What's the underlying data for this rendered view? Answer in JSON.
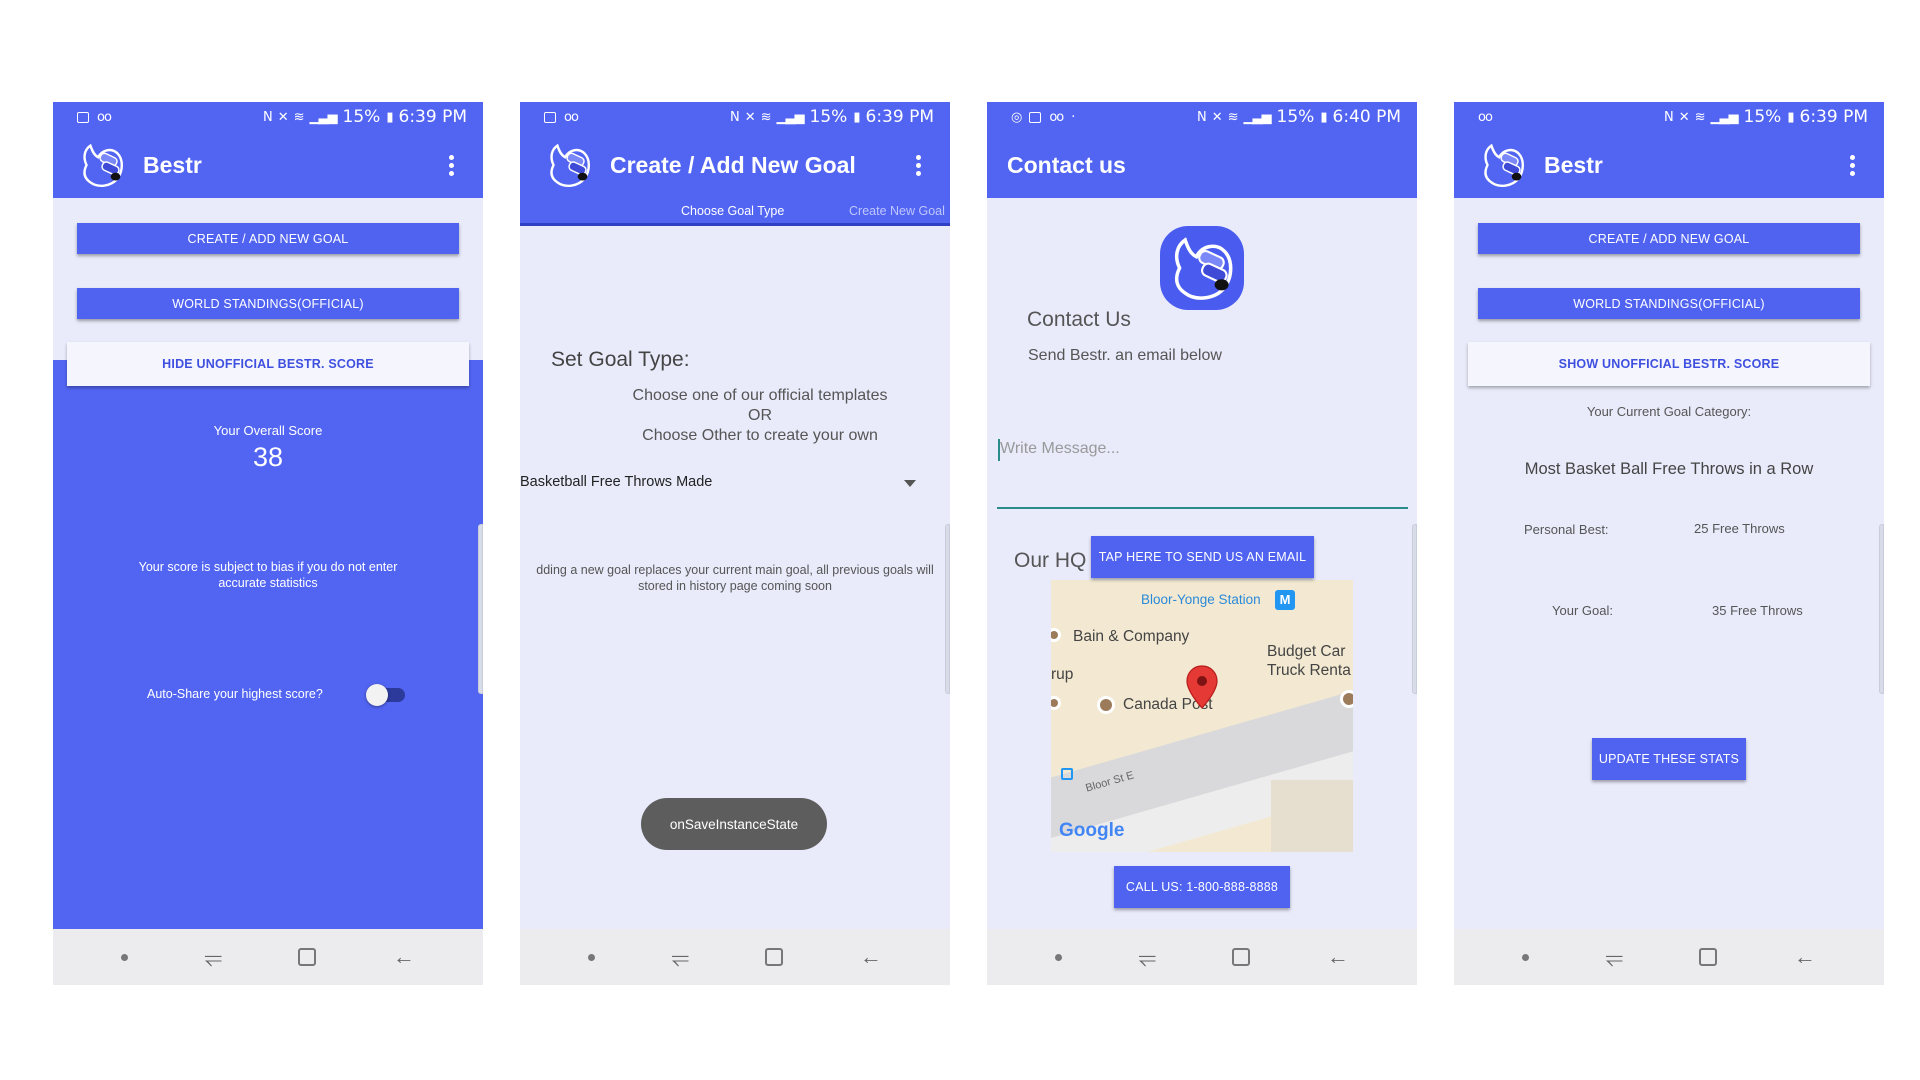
{
  "status": {
    "battery": "15%",
    "time_1": "6:39 PM",
    "time_2": "6:39 PM",
    "time_3": "6:40 PM",
    "time_4": "6:39 PM"
  },
  "screen1": {
    "app_title": "Bestr",
    "create_btn": "CREATE / ADD NEW GOAL",
    "world_btn": "WORLD STANDINGS(OFFICIAL)",
    "hide_btn": "HIDE UNOFFICIAL BESTR. SCORE",
    "score_label": "Your Overall Score",
    "score_value": "38",
    "bias_note": "Your score is subject to bias if you do not enter accurate statistics",
    "autoshare_label": "Auto-Share your highest score?",
    "autoshare_on": false
  },
  "screen2": {
    "app_title": "Create / Add New Goal",
    "tab_1": "Choose Goal Type",
    "tab_2": "Create New Goal",
    "heading": "Set Goal Type:",
    "instr_1": "Choose one of our official templates",
    "instr_or": "OR",
    "instr_2": "Choose Other to create your own",
    "selected_goal": "Basketball Free Throws Made",
    "note": "dding a new goal replaces your current main goal, all previous goals will",
    "note_2": "stored in history page coming soon",
    "toast": "onSaveInstanceState"
  },
  "screen3": {
    "app_title": "Contact us",
    "heading": "Contact Us",
    "sub": "Send Bestr. an email below",
    "message_placeholder": "Write Message...",
    "hq_label": "Our HQ",
    "email_btn": "TAP HERE TO SEND US AN EMAIL",
    "call_btn": "CALL US: 1-800-888-8888",
    "map": {
      "station": "Bloor-Yonge Station",
      "metro_badge": "M",
      "bain": "Bain & Company",
      "budget": "Budget Car",
      "budget_2": "Truck Renta",
      "arup": "rup",
      "canada_post": "Canada Post",
      "street": "Bloor St E",
      "google": "Google"
    }
  },
  "screen4": {
    "app_title": "Bestr",
    "create_btn": "CREATE / ADD NEW GOAL",
    "world_btn": "WORLD STANDINGS(OFFICIAL)",
    "show_btn": "SHOW UNOFFICIAL BESTR. SCORE",
    "category_label": "Your Current Goal Category:",
    "category_value": "Most Basket Ball Free Throws in a Row",
    "personal_best_label": "Personal Best:",
    "personal_best_value": "25 Free Throws",
    "goal_label": "Your Goal:",
    "goal_value": "35 Free Throws",
    "update_btn": "UPDATE THESE STATS"
  },
  "colors": {
    "primary": "#5265f2",
    "background": "#e9ebfb",
    "accent": "#2a8d8a"
  },
  "icons": [
    "image-icon",
    "voicemail-icon",
    "nfc-icon",
    "mute-icon",
    "wifi-icon",
    "signal-icon",
    "battery-icon",
    "kebab-menu-icon",
    "thumbs-up-logo",
    "map-pin-icon",
    "nav-dot-icon",
    "recents-icon",
    "home-icon",
    "back-icon"
  ]
}
